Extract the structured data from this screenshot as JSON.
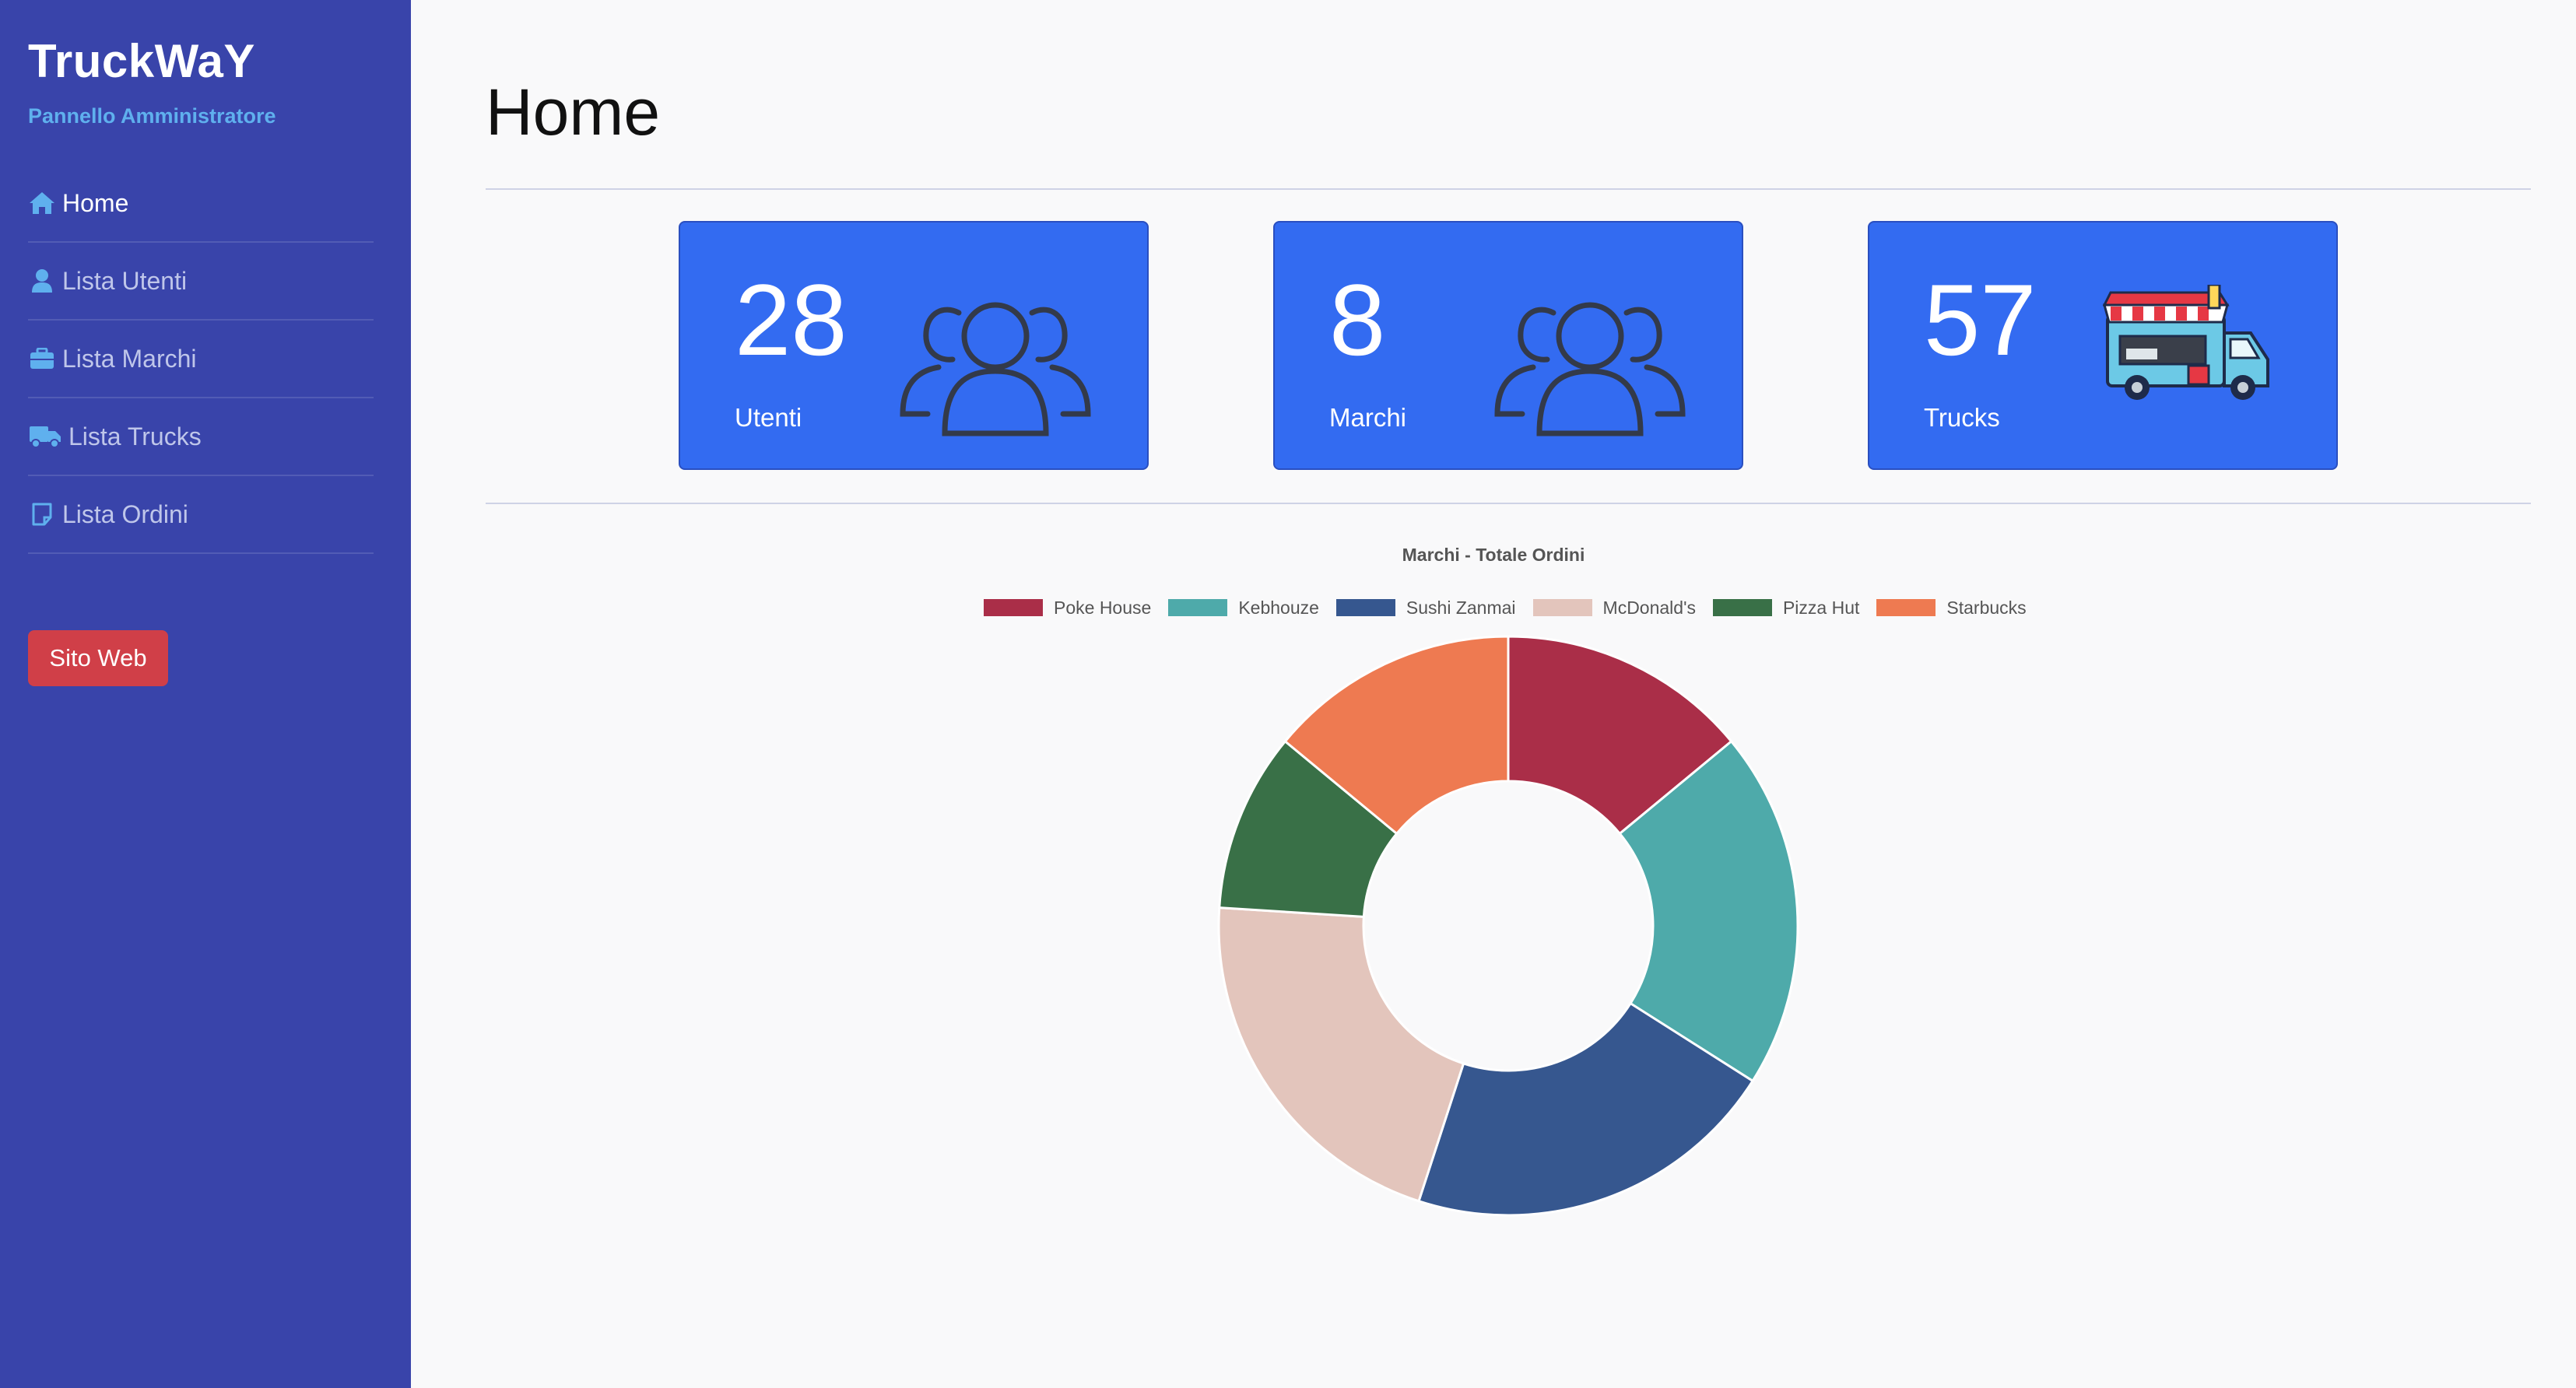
{
  "app": {
    "brand": "TruckWaY",
    "subtitle": "Pannello Amministratore"
  },
  "sidebar": {
    "items": [
      {
        "label": "Home",
        "icon": "home-icon",
        "active": true
      },
      {
        "label": "Lista Utenti",
        "icon": "user-icon",
        "active": false
      },
      {
        "label": "Lista Marchi",
        "icon": "briefcase-icon",
        "active": false
      },
      {
        "label": "Lista Trucks",
        "icon": "truck-icon",
        "active": false
      },
      {
        "label": "Lista Ordini",
        "icon": "note-icon",
        "active": false
      }
    ],
    "site_button": "Sito Web"
  },
  "main": {
    "title": "Home",
    "cards": [
      {
        "value": "28",
        "label": "Utenti",
        "icon": "users-icon"
      },
      {
        "value": "8",
        "label": "Marchi",
        "icon": "users-icon"
      },
      {
        "value": "57",
        "label": "Trucks",
        "icon": "food-truck-icon"
      }
    ]
  },
  "colors": {
    "sidebar": "#3944aa",
    "accent_text": "#5fb0ee",
    "card": "#336bf1",
    "danger": "#d03f48"
  },
  "chart_data": {
    "type": "pie",
    "variant": "doughnut",
    "title": "Marchi - Totale Ordini",
    "legend_position": "top",
    "categories": [
      "Poke House",
      "Kebhouze",
      "Sushi Zanmai",
      "McDonald's",
      "Pizza Hut",
      "Starbucks"
    ],
    "values": [
      14,
      20,
      21,
      21,
      10,
      14
    ],
    "colors": [
      "#aa2e48",
      "#4eaaaa",
      "#36578f",
      "#e3c5bc",
      "#397047",
      "#ee7a51"
    ]
  }
}
